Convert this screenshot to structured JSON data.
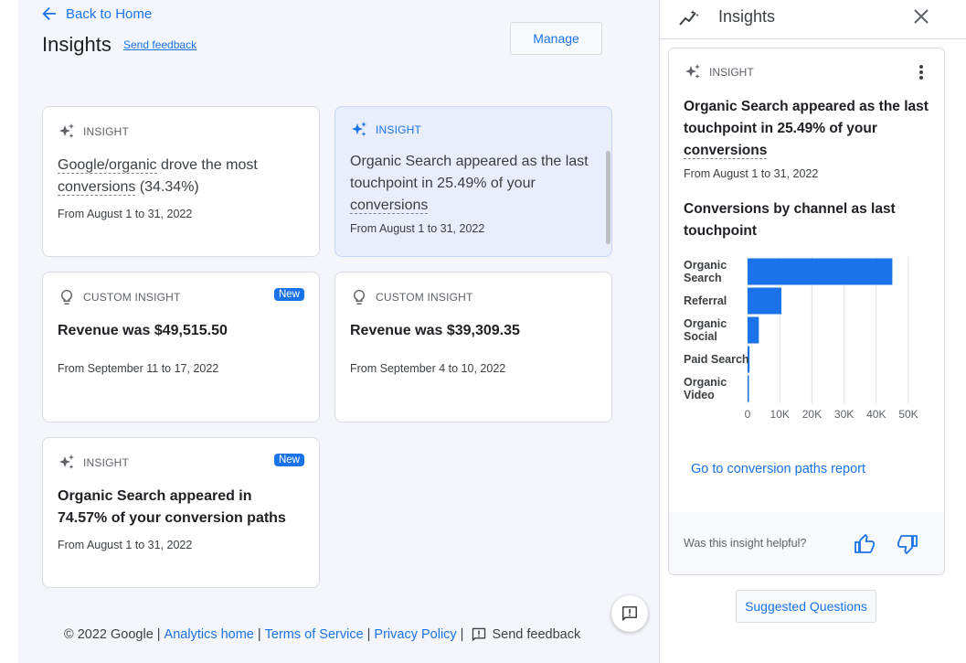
{
  "header": {
    "back_label": "Back to Home",
    "title": "Insights",
    "send_feedback": "Send feedback",
    "manage_label": "Manage"
  },
  "cards": [
    {
      "kind": "INSIGHT",
      "headline_parts": [
        "Google/organic",
        " drove the most ",
        "conversions",
        " (34.34%)"
      ],
      "date": "From August 1 to 31, 2022"
    },
    {
      "kind": "INSIGHT",
      "headline_parts": [
        "Organic Search appeared as the last touchpoint in 25.49% of your ",
        "conversions"
      ],
      "date": "From August 1 to 31, 2022",
      "selected": true
    },
    {
      "kind": "CUSTOM INSIGHT",
      "badge": "New",
      "headline": "Revenue was $49,515.50",
      "date": "From September 11 to 17, 2022"
    },
    {
      "kind": "CUSTOM INSIGHT",
      "headline": "Revenue was $39,309.35",
      "date": "From September 4 to 10, 2022"
    },
    {
      "kind": "INSIGHT",
      "badge": "New",
      "headline": "Organic Search appeared in 74.57% of your conversion paths",
      "date": "From August 1 to 31, 2022"
    }
  ],
  "footer": {
    "copyright": "© 2022 Google",
    "analytics_home": "Analytics home",
    "terms": "Terms of Service",
    "privacy": "Privacy Policy",
    "send_feedback": "Send feedback"
  },
  "panel": {
    "title": "Insights",
    "card": {
      "kind": "INSIGHT",
      "headline_parts": [
        "Organic Search appeared as the last touchpoint in 25.49% of your ",
        "conversions"
      ],
      "date": "From August 1 to 31, 2022",
      "chart_title": "Conversions by channel as last touchpoint",
      "report_link": "Go to conversion paths report",
      "helpful_question": "Was this insight helpful?"
    },
    "suggested_questions": "Suggested Questions"
  },
  "chart_data": {
    "type": "bar",
    "orientation": "horizontal",
    "title": "Conversions by channel as last touchpoint",
    "categories": [
      "Organic Search",
      "Referral",
      "Organic Social",
      "Paid Search",
      "Organic Video"
    ],
    "values": [
      45000,
      10500,
      3500,
      600,
      300
    ],
    "xlim": [
      0,
      50000
    ],
    "xticks": [
      "0",
      "10K",
      "20K",
      "30K",
      "40K",
      "50K"
    ],
    "grid": true,
    "bar_color": "#1a73e8"
  },
  "colors": {
    "accent": "#1a73e8",
    "selected_card_bg": "#e8eefb",
    "main_bg": "#f4f6fb"
  }
}
